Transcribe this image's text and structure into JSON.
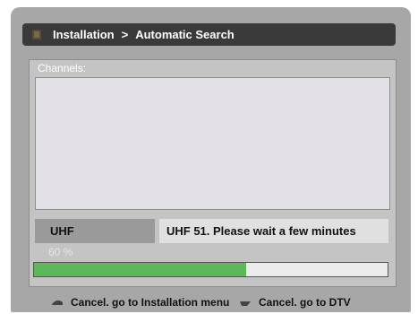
{
  "header": {
    "section": "Installation",
    "separator": ">",
    "page": "Automatic Search"
  },
  "channels": {
    "label": "Channels:",
    "items": []
  },
  "status": {
    "band": "UHF",
    "message": "UHF 51.  Please wait a few minutes"
  },
  "progress": {
    "percent_text": "60 %",
    "value": 0.6,
    "color": "#5cb85a"
  },
  "footer": {
    "items": [
      {
        "icon": "back-key-icon",
        "label": "Cancel. go to Installation menu"
      },
      {
        "icon": "menu-key-icon",
        "label": "Cancel. go to DTV"
      }
    ]
  }
}
